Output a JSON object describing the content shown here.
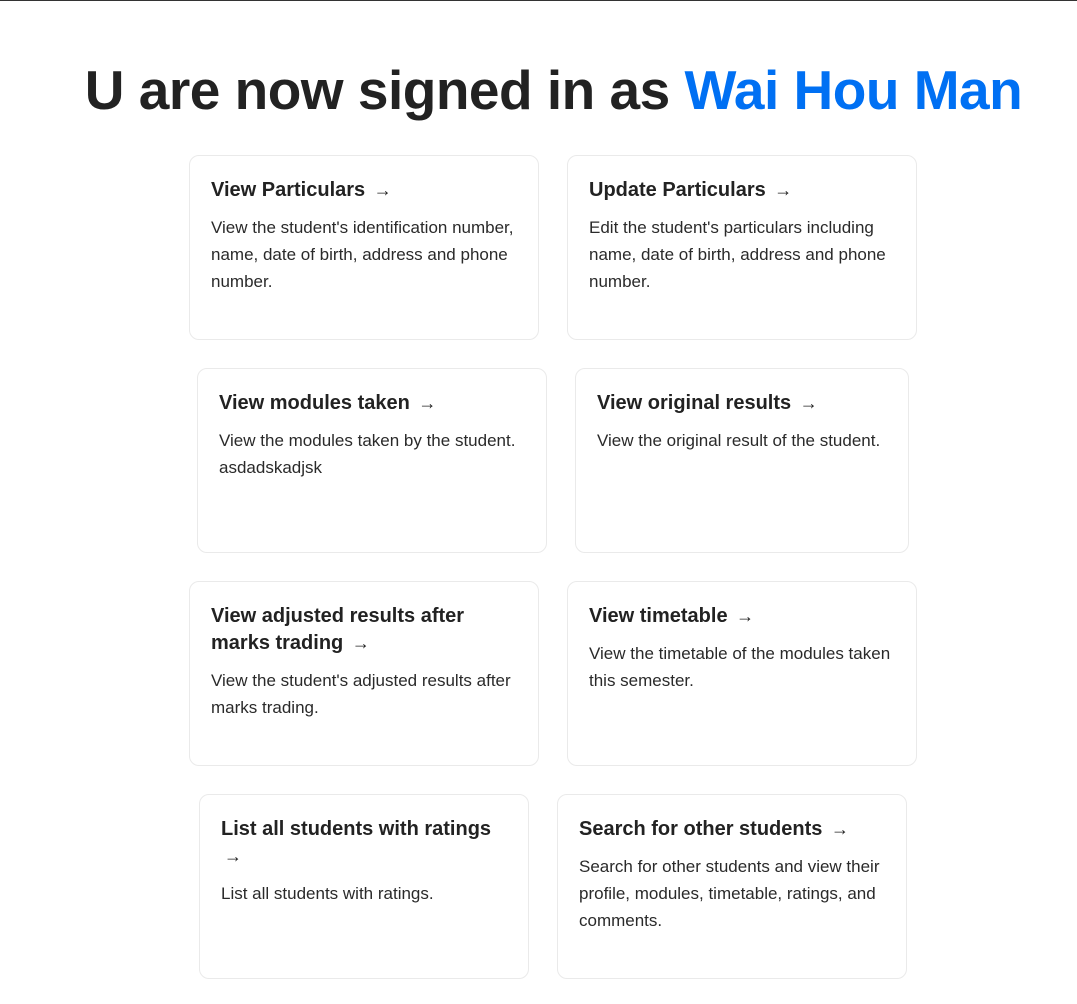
{
  "header": {
    "prefix": "U are now signed in as ",
    "user_name": "Wai Hou Man"
  },
  "cards": [
    {
      "title": "View Particulars",
      "arrow": "→",
      "description": "View the student's identification number, name, date of birth, address and phone number."
    },
    {
      "title": "Update Particulars",
      "arrow": "→",
      "description": "Edit the student's particulars including name, date of birth, address and phone number."
    },
    {
      "title": "View modules taken",
      "arrow": "→",
      "description": "View the modules taken by the student. asdadskadjsk"
    },
    {
      "title": "View original results",
      "arrow": "→",
      "description": "View the original result of the student."
    },
    {
      "title": "View adjusted results after marks trading",
      "arrow": "→",
      "description": "View the student's adjusted results after marks trading."
    },
    {
      "title": "View timetable",
      "arrow": "→",
      "description": "View the timetable of the modules taken this semester."
    },
    {
      "title": "List all students with ratings",
      "arrow": "→",
      "description": "List all students with ratings."
    },
    {
      "title": "Search for other students",
      "arrow": "→",
      "description": "Search for other students and view their profile, modules, timetable, ratings, and comments."
    }
  ]
}
